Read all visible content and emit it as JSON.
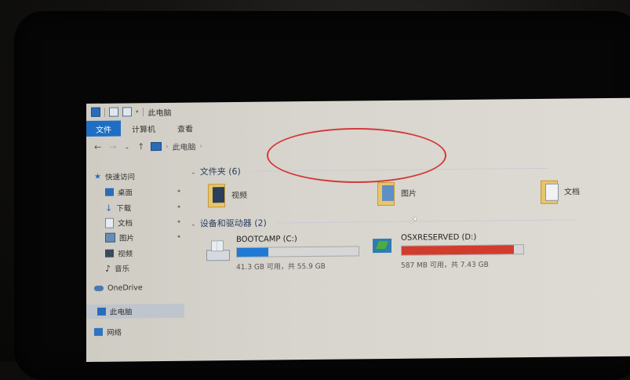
{
  "window": {
    "title": "此电脑"
  },
  "ribbon": {
    "tabs": [
      "文件",
      "计算机",
      "查看"
    ]
  },
  "address": {
    "back": "←",
    "forward": "→",
    "recent": "⌄",
    "up": "↑",
    "path": [
      "此电脑"
    ]
  },
  "sidebar": {
    "quick_access": "快速访问",
    "items": [
      {
        "label": "桌面",
        "icon": "desktop-icon",
        "pinned": true
      },
      {
        "label": "下载",
        "icon": "download-icon",
        "pinned": true
      },
      {
        "label": "文档",
        "icon": "documents-icon",
        "pinned": true
      },
      {
        "label": "图片",
        "icon": "pictures-icon",
        "pinned": true
      },
      {
        "label": "视频",
        "icon": "videos-icon",
        "pinned": false
      },
      {
        "label": "音乐",
        "icon": "music-icon",
        "pinned": false
      }
    ],
    "onedrive": "OneDrive",
    "this_pc": "此电脑",
    "network": "网络"
  },
  "content": {
    "folders_header": "文件夹 (6)",
    "folders": [
      {
        "label": "视频"
      },
      {
        "label": "图片"
      },
      {
        "label": "文档"
      }
    ],
    "drives_header": "设备和驱动器 (2)",
    "drives": [
      {
        "name": "BOOTCAMP (C:)",
        "size_text": "41.3 GB 可用，共 55.9 GB",
        "used_fraction": 0.26,
        "bar_color": "#1e7ad6"
      },
      {
        "name": "OSXRESERVED (D:)",
        "size_text": "587 MB 可用，共 7.43 GB",
        "used_fraction": 0.92,
        "bar_color": "#d23c2c"
      }
    ]
  }
}
